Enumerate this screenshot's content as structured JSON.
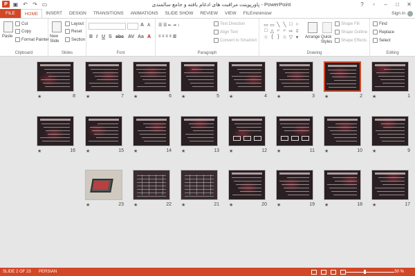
{
  "window": {
    "title": "پاورپوینت مراقبت های ادغام یافته و جامع سالمندی - PowerPoint",
    "signin": "Sign in"
  },
  "tabs": [
    "FILE",
    "HOME",
    "INSERT",
    "DESIGN",
    "TRANSITIONS",
    "ANIMATIONS",
    "SLIDE SHOW",
    "REVIEW",
    "VIEW",
    "FILEminimizer"
  ],
  "ribbon": {
    "clipboard": {
      "label": "Clipboard",
      "paste": "Paste",
      "cut": "Cut",
      "copy": "Copy",
      "format_painter": "Format Painter"
    },
    "slides": {
      "label": "Slides",
      "new_slide": "New Slide",
      "layout": "Layout",
      "reset": "Reset",
      "section": "Section"
    },
    "font": {
      "label": "Font"
    },
    "paragraph": {
      "label": "Paragraph",
      "text_direction": "Text Direction",
      "align_text": "Align Text",
      "smartart": "Convert to SmartArt"
    },
    "drawing": {
      "label": "Drawing",
      "arrange": "Arrange",
      "quick_styles": "Quick Styles",
      "shape_fill": "Shape Fill",
      "shape_outline": "Shape Outline",
      "shape_effects": "Shape Effects"
    },
    "editing": {
      "label": "Editing",
      "find": "Find",
      "replace": "Replace",
      "select": "Select"
    }
  },
  "slides": [
    {
      "num": "1",
      "kind": "text"
    },
    {
      "num": "2",
      "kind": "text",
      "selected": true
    },
    {
      "num": "3",
      "kind": "text"
    },
    {
      "num": "4",
      "kind": "text"
    },
    {
      "num": "5",
      "kind": "text"
    },
    {
      "num": "6",
      "kind": "text"
    },
    {
      "num": "7",
      "kind": "text"
    },
    {
      "num": "8",
      "kind": "text"
    },
    {
      "num": "9",
      "kind": "text"
    },
    {
      "num": "10",
      "kind": "text"
    },
    {
      "num": "11",
      "kind": "diagram"
    },
    {
      "num": "12",
      "kind": "diagram"
    },
    {
      "num": "13",
      "kind": "text"
    },
    {
      "num": "14",
      "kind": "text"
    },
    {
      "num": "15",
      "kind": "text"
    },
    {
      "num": "16",
      "kind": "text"
    },
    {
      "num": "17",
      "kind": "text"
    },
    {
      "num": "18",
      "kind": "text"
    },
    {
      "num": "19",
      "kind": "text"
    },
    {
      "num": "20",
      "kind": "text"
    },
    {
      "num": "21",
      "kind": "table"
    },
    {
      "num": "22",
      "kind": "table"
    },
    {
      "num": "23",
      "kind": "photo"
    }
  ],
  "star_glyph": "★",
  "status": {
    "slide_count": "SLIDE 2 OF 23",
    "language": "PERSIAN",
    "zoom": "50 %"
  }
}
